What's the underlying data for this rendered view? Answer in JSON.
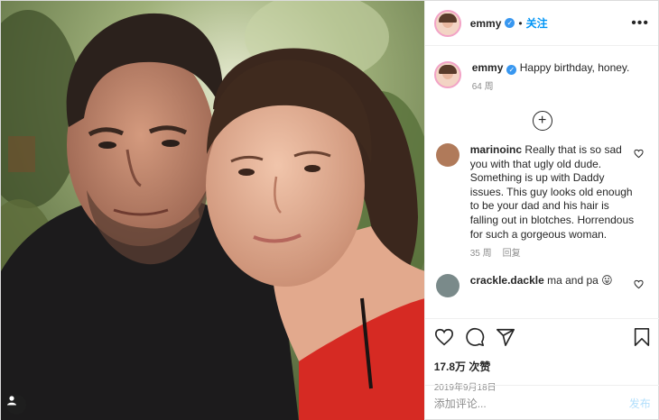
{
  "post": {
    "username": "emmy",
    "verified_mark": "✓",
    "dot": "•",
    "follow_label": "关注",
    "more_label": "•••",
    "caption": {
      "username": "emmy",
      "text": "Happy birthday, honey.",
      "age": "64 周"
    },
    "load_more_label": "+",
    "comments": [
      {
        "username": "marinoinc",
        "text": "Really that is so sad you with that ugly old dude. Something is up with Daddy issues. This guy looks old enough to be your dad and his hair is falling out in blotches. Horrendous for such a gorgeous woman.",
        "age": "35 周",
        "reply_label": "回复",
        "avatar_color": "#b07a5a"
      },
      {
        "username": "crackle.dackle",
        "text": "ma and pa 😛",
        "avatar_color": "#7a8a8a"
      }
    ],
    "likes": "17.8万 次赞",
    "date": "2019年9月18日",
    "add_comment_placeholder": "添加评论...",
    "post_label": "发布",
    "icons": {
      "like": "heart-icon",
      "comment": "comment-icon",
      "share": "share-icon",
      "save": "bookmark-icon",
      "user_tag": "user-tag-icon"
    },
    "colors": {
      "accent": "#0095f6",
      "verified": "#3897f0",
      "muted": "#8e8e8e",
      "post_disabled": "#b2dffc"
    }
  }
}
